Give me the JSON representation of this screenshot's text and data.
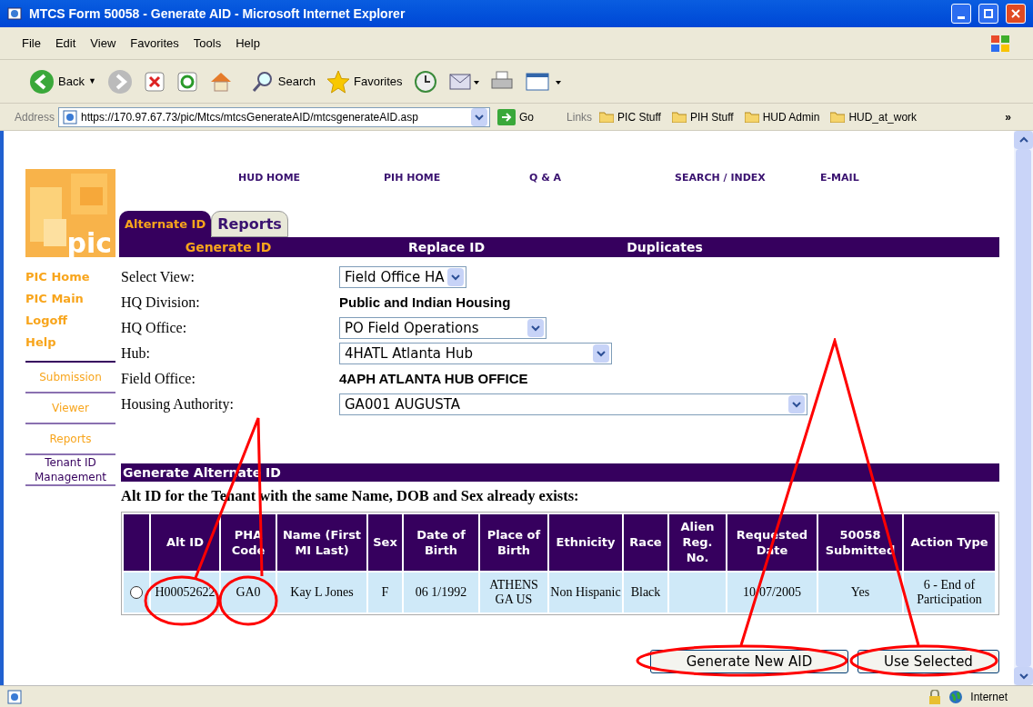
{
  "window": {
    "title": "MTCS Form 50058 - Generate AID - Microsoft Internet Explorer"
  },
  "menu": [
    "File",
    "Edit",
    "View",
    "Favorites",
    "Tools",
    "Help"
  ],
  "toolbar": {
    "back": "Back",
    "back_menu": "▼",
    "search": "Search",
    "favorites": "Favorites"
  },
  "address": {
    "label": "Address",
    "url": "https://170.97.67.73/pic/Mtcs/mtcsGenerateAID/mtcsgenerateAID.asp",
    "go": "Go"
  },
  "links": {
    "label": "Links",
    "items": [
      "PIC Stuff",
      "PIH Stuff",
      "HUD Admin",
      "HUD_at_work"
    ],
    "more": "»"
  },
  "logo": {
    "text": "pic"
  },
  "nav": [
    "HUD HOME",
    "PIH HOME",
    "Q & A",
    "SEARCH / INDEX",
    "E-MAIL"
  ],
  "tabs": [
    {
      "label": "Alternate ID",
      "selected": true
    },
    {
      "label": "Reports",
      "selected": false
    }
  ],
  "subtabs": [
    {
      "label": "Generate ID",
      "selected": true
    },
    {
      "label": "Replace ID",
      "selected": false
    },
    {
      "label": "Duplicates",
      "selected": false
    }
  ],
  "sidebar": {
    "primary": [
      "PIC Home",
      "PIC Main",
      "Logoff",
      "Help"
    ],
    "secondary": [
      {
        "label": "Submission",
        "selected": false
      },
      {
        "label": "Viewer",
        "selected": false
      },
      {
        "label": "Reports",
        "selected": false
      },
      {
        "label": "Tenant ID Management",
        "selected": true
      }
    ]
  },
  "form": [
    {
      "label": "Select View:",
      "kind": "select",
      "value": "Field Office HA"
    },
    {
      "label": "HQ Division:",
      "kind": "text",
      "value": "Public and Indian Housing"
    },
    {
      "label": "HQ Office:",
      "kind": "select",
      "value": "PO Field Operations"
    },
    {
      "label": "Hub:",
      "kind": "select",
      "value": "4HATL Atlanta Hub"
    },
    {
      "label": "Field Office:",
      "kind": "text",
      "value": "4APH ATLANTA HUB OFFICE"
    },
    {
      "label": "Housing Authority:",
      "kind": "select",
      "value": "GA001 AUGUSTA"
    }
  ],
  "section": {
    "title": "Generate Alternate ID",
    "message": "Alt ID for the Tenant with the same Name, DOB and Sex already exists:"
  },
  "table": {
    "columns": [
      "Alt ID",
      "PHA Code",
      "Name (First MI Last)",
      "Sex",
      "Date of Birth",
      "Place of Birth",
      "Ethnicity",
      "Race",
      "Alien Reg. No.",
      "Requested Date",
      "50058 Submitted",
      "Action Type"
    ],
    "rows": [
      {
        "selected": false,
        "cells": [
          "H00052622",
          "GA0",
          "Kay L Jones",
          "F",
          "06 1/1992",
          "ATHENS GA US",
          "Non Hispanic",
          "Black",
          "",
          "10/07/2005",
          "Yes",
          "6 - End of Participation"
        ]
      }
    ]
  },
  "buttons": [
    "Generate New AID",
    "Use Selected"
  ],
  "status": {
    "zone": "Internet"
  }
}
